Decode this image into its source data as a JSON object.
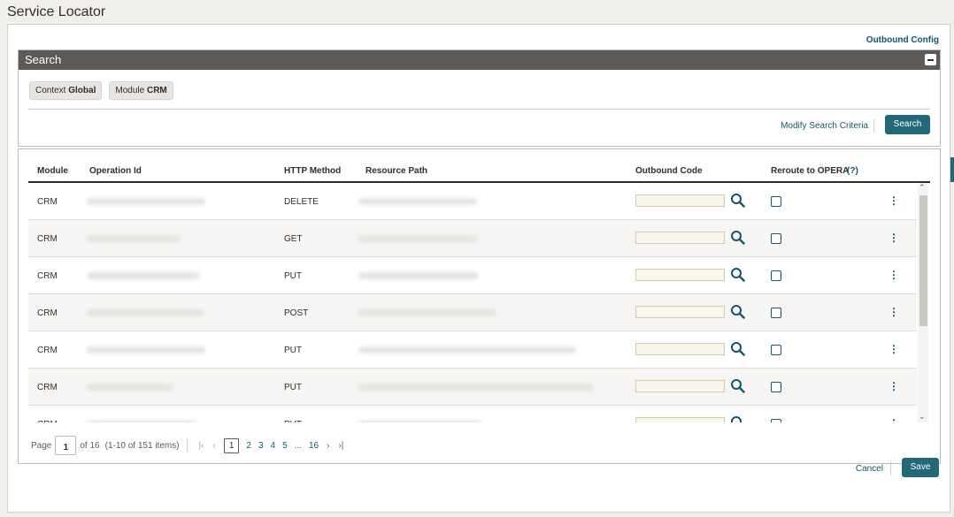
{
  "title": "Service Locator",
  "outbound_config": "Outbound Config",
  "search": {
    "header": "Search",
    "chips": [
      {
        "key": "Context",
        "value": "Global"
      },
      {
        "key": "Module",
        "value": "CRM"
      }
    ],
    "modify_link": "Modify Search Criteria",
    "search_button": "Search"
  },
  "table": {
    "columns": [
      "Module",
      "Operation Id",
      "HTTP Method",
      "Resource Path",
      "Outbound Code",
      "Reroute to OPERA",
      "(?)"
    ],
    "rows": [
      {
        "module": "CRM",
        "http": "DELETE",
        "op_w": 134,
        "res_w": 134
      },
      {
        "module": "CRM",
        "http": "GET",
        "op_w": 106,
        "res_w": 134
      },
      {
        "module": "CRM",
        "http": "PUT",
        "op_w": 128,
        "res_w": 136
      },
      {
        "module": "CRM",
        "http": "POST",
        "op_w": 132,
        "res_w": 156
      },
      {
        "module": "CRM",
        "http": "PUT",
        "op_w": 134,
        "res_w": 246
      },
      {
        "module": "CRM",
        "http": "PUT",
        "op_w": 98,
        "res_w": 266
      },
      {
        "module": "CRM",
        "http": "PUT",
        "op_w": 124,
        "res_w": 140
      }
    ]
  },
  "pagination": {
    "page_label": "Page",
    "current_page": "1",
    "of_total": "of 16",
    "items_info": "(1-10 of 151 items)",
    "pages": [
      "1",
      "2",
      "3",
      "4",
      "5",
      "...",
      "16"
    ]
  },
  "footer": {
    "cancel": "Cancel",
    "save": "Save"
  }
}
